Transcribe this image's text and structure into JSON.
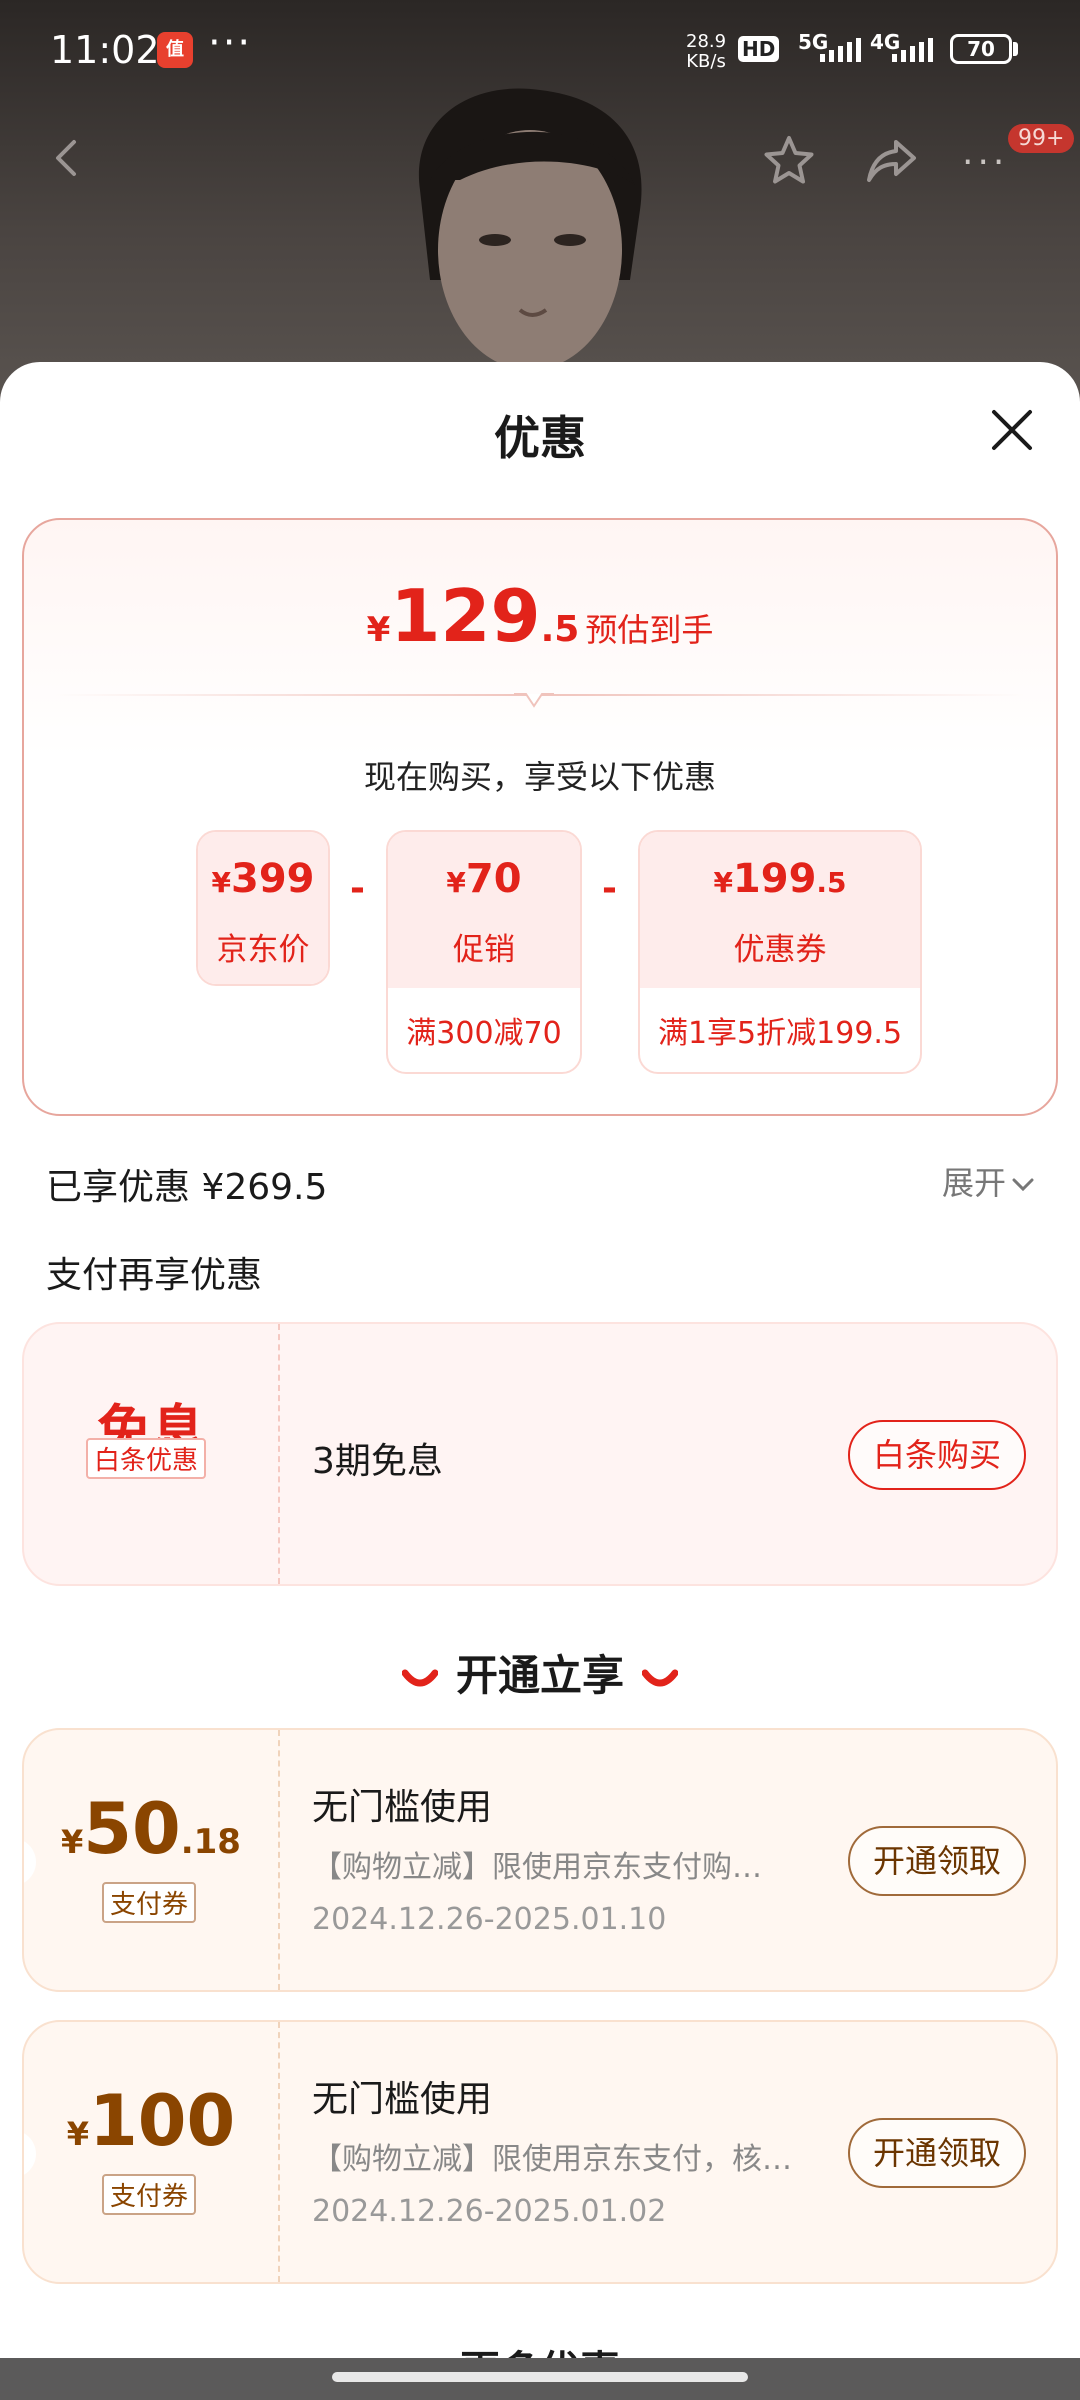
{
  "status_bar": {
    "time": "11:02",
    "app_icon_text": "值",
    "more": "···",
    "speed_value": "28.9",
    "speed_unit": "KB/s",
    "hd": "HD",
    "net1": "5G",
    "net2": "4G",
    "battery": "70"
  },
  "nav": {
    "more": "···",
    "badge": "99+"
  },
  "sheet": {
    "title": "优惠",
    "estimate": {
      "currency": "¥",
      "integer": "129",
      "decimal": ".5",
      "label": "预估到手"
    },
    "buy_now_text": "现在购买，享受以下优惠",
    "breakdown": [
      {
        "currency": "¥",
        "amount": "399",
        "decimal": "",
        "name": "京东价",
        "desc": ""
      },
      {
        "currency": "¥",
        "amount": "70",
        "decimal": "",
        "name": "促销",
        "desc": "满300减70"
      },
      {
        "currency": "¥",
        "amount": "199",
        "decimal": ".5",
        "name": "优惠券",
        "desc": "满1享5折减199.5"
      }
    ],
    "minus": "-",
    "saved": "已享优惠 ¥269.5",
    "expand": "展开",
    "pay_more": "支付再享优惠",
    "interest_free": {
      "title": "免息",
      "tag": "白条优惠",
      "desc": "3期免息",
      "button": "白条购买"
    },
    "open_heading": "开通立享",
    "pay_coupons": [
      {
        "currency": "¥",
        "amount": "50",
        "decimal": ".18",
        "tag": "支付券",
        "title": "无门槛使用",
        "desc": "【购物立减】限使用京东支付购…",
        "date": "2024.12.26-2025.01.10",
        "button": "开通领取"
      },
      {
        "currency": "¥",
        "amount": "100",
        "decimal": "",
        "tag": "支付券",
        "title": "无门槛使用",
        "desc": "【购物立减】限使用京东支付，核…",
        "date": "2024.12.26-2025.01.02",
        "button": "开通领取"
      }
    ],
    "more_peek": "更多优惠"
  },
  "colors": {
    "accent_red": "#e2231a",
    "coupon_brown": "#8a4500"
  }
}
